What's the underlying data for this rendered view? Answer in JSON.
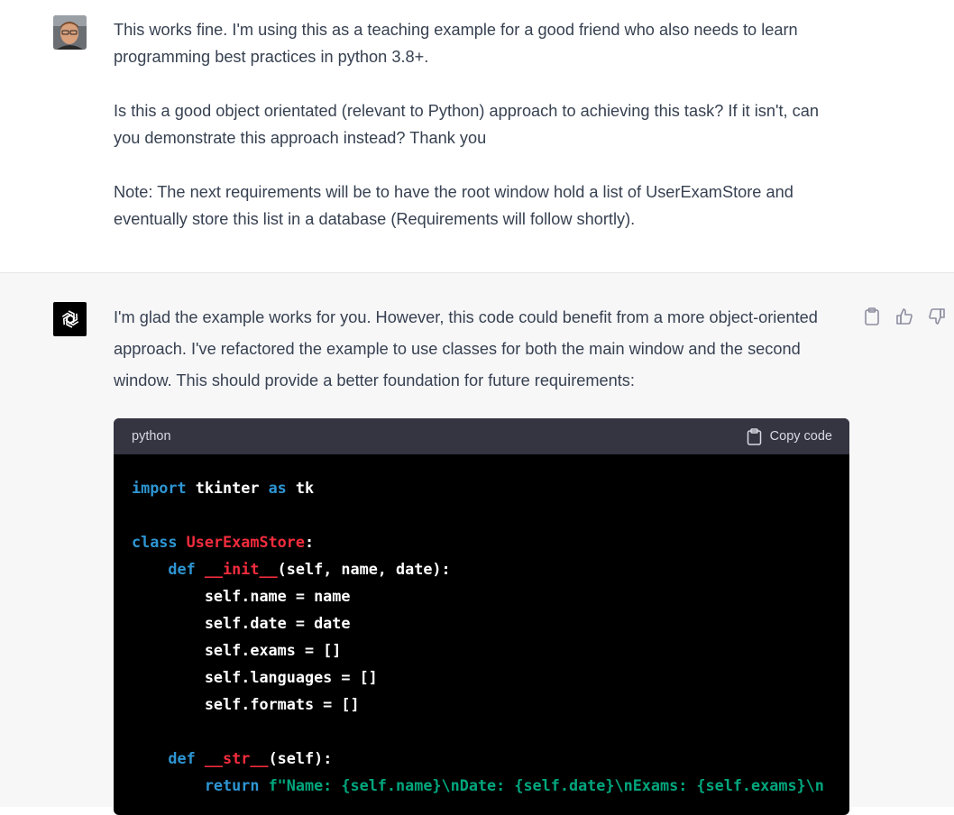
{
  "user_message": {
    "paragraphs": [
      "This works fine. I'm using this as a teaching example for a good friend who also needs to learn programming best practices in python 3.8+.",
      "Is this a good object orientated (relevant to Python) approach to achieving this task? If it isn't, can you demonstrate this approach instead? Thank you",
      "Note: The next requirements will be to have the root window hold a list of UserExamStore and eventually store this list in a database (Requirements will follow shortly)."
    ]
  },
  "assistant_message": {
    "intro": "I'm glad the example works for you. However, this code could benefit from a more object-oriented approach. I've refactored the example to use classes for both the main window and the second window. This should provide a better foundation for future requirements:",
    "actions": {
      "copy_icon": "clipboard-icon",
      "like_icon": "thumbs-up-icon",
      "dislike_icon": "thumbs-down-icon"
    },
    "code_block": {
      "language": "python",
      "copy_label": "Copy code",
      "lines": [
        [
          {
            "t": "import",
            "c": "kw"
          },
          {
            "t": " tkinter ",
            "c": "plain"
          },
          {
            "t": "as",
            "c": "kw"
          },
          {
            "t": " tk",
            "c": "plain"
          }
        ],
        [],
        [
          {
            "t": "class",
            "c": "kw"
          },
          {
            "t": " ",
            "c": "plain"
          },
          {
            "t": "UserExamStore",
            "c": "cls"
          },
          {
            "t": ":",
            "c": "plain"
          }
        ],
        [
          {
            "t": "    ",
            "c": "plain"
          },
          {
            "t": "def",
            "c": "kw"
          },
          {
            "t": " ",
            "c": "plain"
          },
          {
            "t": "__init__",
            "c": "cls"
          },
          {
            "t": "(self, name, date):",
            "c": "plain"
          }
        ],
        [
          {
            "t": "        self.name = name",
            "c": "plain"
          }
        ],
        [
          {
            "t": "        self.date = date",
            "c": "plain"
          }
        ],
        [
          {
            "t": "        self.exams = []",
            "c": "plain"
          }
        ],
        [
          {
            "t": "        self.languages = []",
            "c": "plain"
          }
        ],
        [
          {
            "t": "        self.formats = []",
            "c": "plain"
          }
        ],
        [],
        [
          {
            "t": "    ",
            "c": "plain"
          },
          {
            "t": "def",
            "c": "kw"
          },
          {
            "t": " ",
            "c": "plain"
          },
          {
            "t": "__str__",
            "c": "cls"
          },
          {
            "t": "(self):",
            "c": "plain"
          }
        ],
        [
          {
            "t": "        ",
            "c": "plain"
          },
          {
            "t": "return",
            "c": "kw"
          },
          {
            "t": " ",
            "c": "plain"
          },
          {
            "t": "f\"Name: {self.name}\\nDate: {self.date}\\nExams: {self.exams}\\n",
            "c": "str"
          }
        ]
      ]
    }
  },
  "colors": {
    "keyword": "#2e95d3",
    "class_name": "#f22c3d",
    "string": "#00a67d",
    "code_bg": "#000000",
    "code_header_bg": "#343541",
    "assistant_bg": "#f7f7f8"
  }
}
